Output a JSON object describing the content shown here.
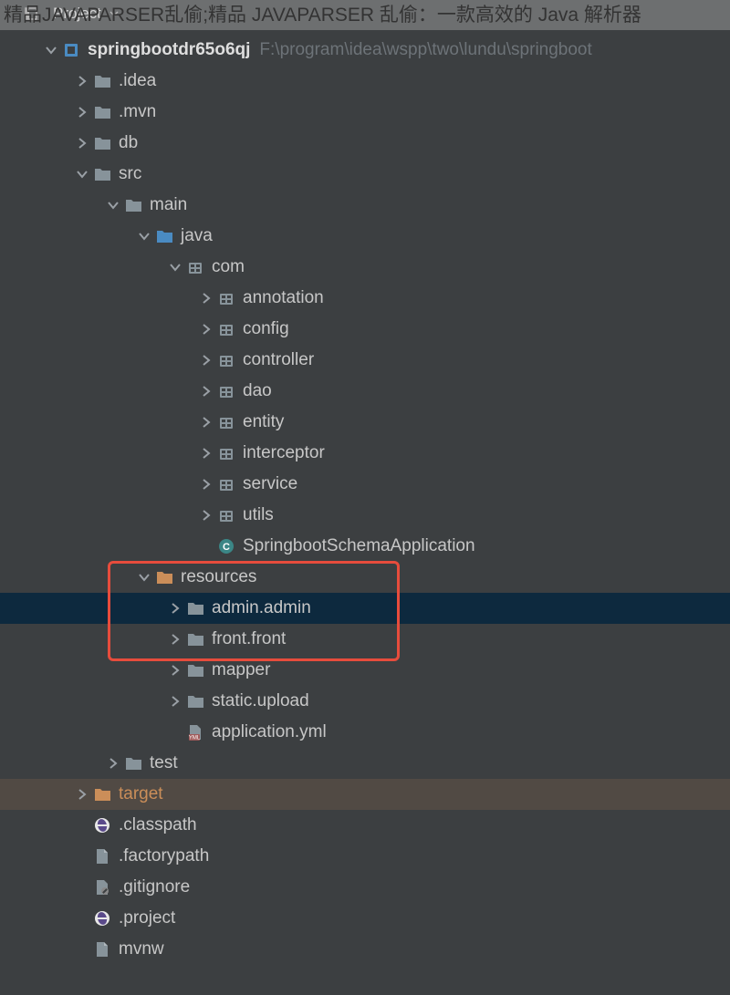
{
  "overlay": {
    "text": "精品JAVAPARSER乱偷;精品 JAVAPARSER 乱偷：一款高效的 Java 解析器"
  },
  "toolbar": {
    "title": "Project"
  },
  "root": {
    "name": "springbootdr65o6qj",
    "path": "F:\\program\\idea\\wspp\\two\\lundu\\springboot"
  },
  "tree": {
    "idea": ".idea",
    "mvn": ".mvn",
    "db": "db",
    "src": "src",
    "main": "main",
    "java": "java",
    "com": "com",
    "annotation": "annotation",
    "config": "config",
    "controller": "controller",
    "dao": "dao",
    "entity": "entity",
    "interceptor": "interceptor",
    "service": "service",
    "utils": "utils",
    "springbootApp": "SpringbootSchemaApplication",
    "resources": "resources",
    "adminAdmin": "admin.admin",
    "frontFront": "front.front",
    "mapper": "mapper",
    "staticUpload": "static.upload",
    "applicationYml": "application.yml",
    "test": "test",
    "target": "target",
    "classpath": ".classpath",
    "factorypath": ".factorypath",
    "gitignore": ".gitignore",
    "project": ".project",
    "mvnw": "mvnw"
  }
}
